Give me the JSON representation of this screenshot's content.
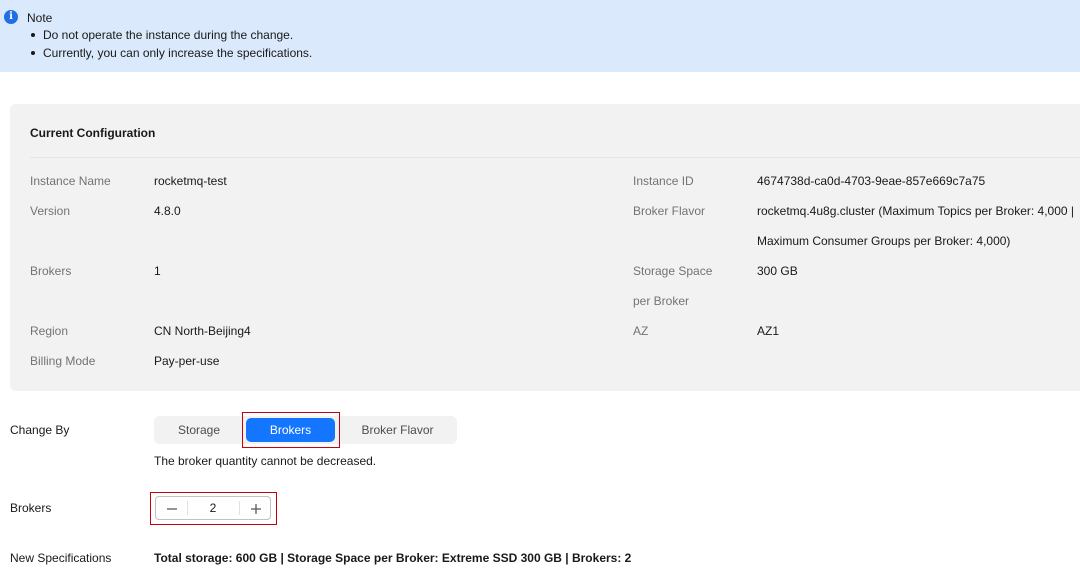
{
  "note": {
    "title": "Note",
    "items": [
      "Do not operate the instance during the change.",
      "Currently, you can only increase the specifications."
    ]
  },
  "current_configuration": {
    "title": "Current Configuration",
    "instance_name": {
      "label": "Instance Name",
      "value": "rocketmq-test"
    },
    "version": {
      "label": "Version",
      "value": "4.8.0"
    },
    "brokers": {
      "label": "Brokers",
      "value": "1"
    },
    "region": {
      "label": "Region",
      "value": "CN North-Beijing4"
    },
    "billing_mode": {
      "label": "Billing Mode",
      "value": "Pay-per-use"
    },
    "instance_id": {
      "label": "Instance ID",
      "value": "4674738d-ca0d-4703-9eae-857e669c7a75"
    },
    "broker_flavor": {
      "label": "Broker Flavor",
      "value_line1": "rocketmq.4u8g.cluster (Maximum Topics per Broker: 4,000 |",
      "value_line2": "Maximum Consumer Groups per Broker: 4,000)"
    },
    "storage_space": {
      "label_line1": "Storage Space",
      "label_line2": "per Broker",
      "value": "300 GB"
    },
    "az": {
      "label": "AZ",
      "value": "AZ1"
    }
  },
  "change_by": {
    "label": "Change By",
    "options": [
      "Storage",
      "Brokers",
      "Broker Flavor"
    ],
    "selected": "Brokers",
    "hint": "The broker quantity cannot be decreased."
  },
  "brokers_field": {
    "label": "Brokers",
    "value": "2"
  },
  "new_specifications": {
    "label": "New Specifications",
    "value": "Total storage: 600 GB | Storage Space per Broker: Extreme SSD 300 GB | Brokers: 2"
  },
  "colors": {
    "accent": "#1476ff",
    "note_background": "#dbe9fc",
    "highlight_border": "#c7000b"
  },
  "icons": {
    "note": "info-circle-icon",
    "decrease": "minus-icon",
    "increase": "plus-icon"
  }
}
